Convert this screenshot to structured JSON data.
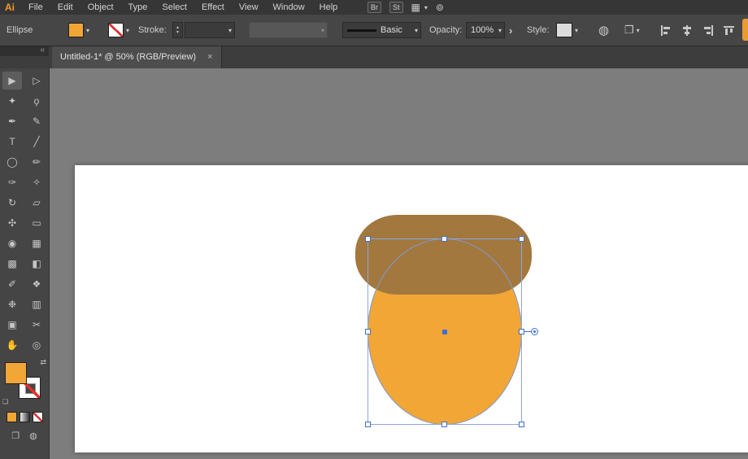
{
  "app": {
    "logo_text": "Ai"
  },
  "menubar": {
    "items": [
      "File",
      "Edit",
      "Object",
      "Type",
      "Select",
      "Effect",
      "View",
      "Window",
      "Help"
    ],
    "br_button": "Br",
    "st_button": "St"
  },
  "tabbar": {
    "panel_collapse": "«",
    "tab_title": "Untitled-1* @ 50% (RGB/Preview)",
    "close_label": "×"
  },
  "controlbar": {
    "context_label": "Ellipse",
    "stroke_label": "Stroke:",
    "stroke_value": "",
    "brush_profile_label": "Basic",
    "opacity_label": "Opacity:",
    "opacity_value": "100%",
    "style_label": "Style:",
    "align_buttons": [
      "align-horizontal-left",
      "align-horizontal-center",
      "align-horizontal-right",
      "align-vertical-top"
    ]
  },
  "icons": {
    "caret_down": "▾",
    "stepper_up": "▴",
    "stepper_down": "▾",
    "workspace": "▦",
    "stock_search": "⊚",
    "globe": "◍",
    "document_setup": "❐",
    "opacity_chevron": "›",
    "swap_fill_stroke": "⇄",
    "default_fill_stroke": "❏",
    "draw_mode": "❐",
    "screen_mode": "◍"
  },
  "toolbar": {
    "tools": [
      {
        "name": "selection-tool",
        "glyph": "▶",
        "selected": true
      },
      {
        "name": "direct-selection-tool",
        "glyph": "▷",
        "selected": false
      },
      {
        "name": "magic-wand-tool",
        "glyph": "✦",
        "selected": false
      },
      {
        "name": "lasso-tool",
        "glyph": "ϙ",
        "selected": false
      },
      {
        "name": "pen-tool",
        "glyph": "✒",
        "selected": false
      },
      {
        "name": "curvature-tool",
        "glyph": "✎",
        "selected": false
      },
      {
        "name": "type-tool",
        "glyph": "T",
        "selected": false
      },
      {
        "name": "line-segment-tool",
        "glyph": "╱",
        "selected": false
      },
      {
        "name": "ellipse-tool",
        "glyph": "◯",
        "selected": false
      },
      {
        "name": "paintbrush-tool",
        "glyph": "✏",
        "selected": false
      },
      {
        "name": "pencil-tool",
        "glyph": "✑",
        "selected": false
      },
      {
        "name": "shaper-tool",
        "glyph": "✧",
        "selected": false
      },
      {
        "name": "rotate-tool",
        "glyph": "↻",
        "selected": false
      },
      {
        "name": "scale-tool",
        "glyph": "▱",
        "selected": false
      },
      {
        "name": "width-tool",
        "glyph": "✣",
        "selected": false
      },
      {
        "name": "free-transform-tool",
        "glyph": "▭",
        "selected": false
      },
      {
        "name": "shape-builder-tool",
        "glyph": "◉",
        "selected": false
      },
      {
        "name": "perspective-grid-tool",
        "glyph": "▦",
        "selected": false
      },
      {
        "name": "mesh-tool",
        "glyph": "▩",
        "selected": false
      },
      {
        "name": "gradient-tool",
        "glyph": "◧",
        "selected": false
      },
      {
        "name": "eyedropper-tool",
        "glyph": "✐",
        "selected": false
      },
      {
        "name": "blend-tool",
        "glyph": "❖",
        "selected": false
      },
      {
        "name": "symbol-sprayer-tool",
        "glyph": "❉",
        "selected": false
      },
      {
        "name": "column-graph-tool",
        "glyph": "▥",
        "selected": false
      },
      {
        "name": "artboard-tool",
        "glyph": "▣",
        "selected": false
      },
      {
        "name": "slice-tool",
        "glyph": "✂",
        "selected": false
      },
      {
        "name": "hand-tool",
        "glyph": "✋",
        "selected": false
      },
      {
        "name": "zoom-tool",
        "glyph": "◎",
        "selected": false
      }
    ]
  },
  "colors": {
    "fill_orange": "#F2A636",
    "cap_brown": "#A2783F",
    "selection_blue": "#3F6FD0",
    "bbox_blue": "#8AA7E2",
    "artboard_white": "#FFFFFF",
    "pasteboard_gray": "#7D7D7D"
  }
}
